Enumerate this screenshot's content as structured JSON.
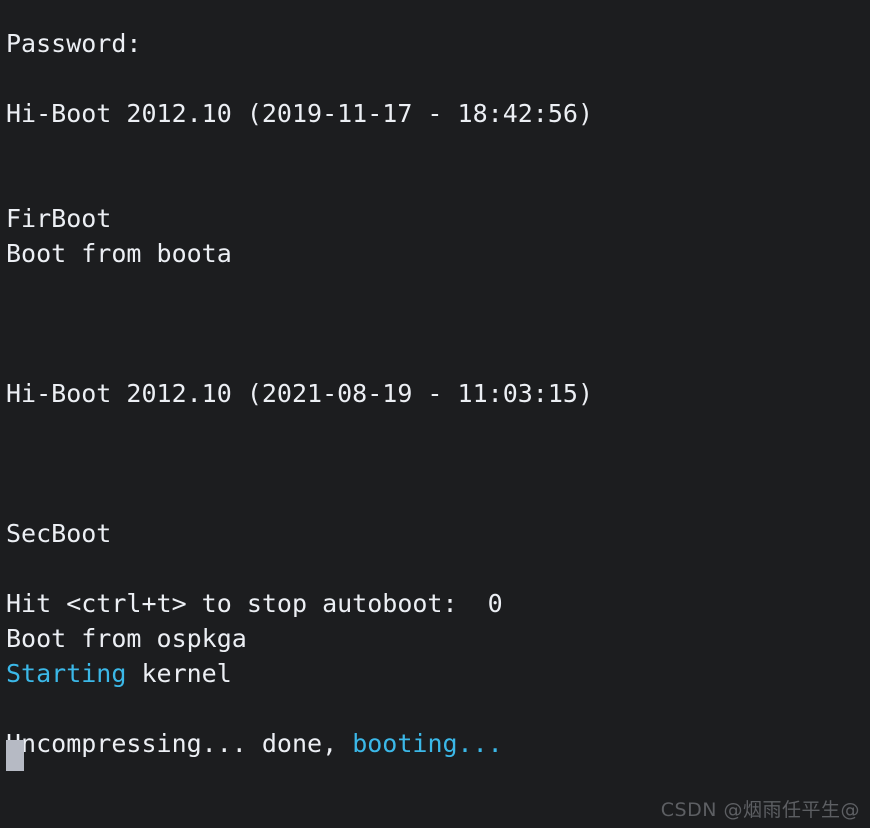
{
  "terminal": {
    "background_color": "#1c1d1f",
    "default_text_color": "#eceff4",
    "highlight_text_color": "#3bb8e8",
    "cursor_color": "#b6bac4",
    "lines": [
      {
        "id": "password-prompt",
        "segments": [
          {
            "text": "Password:",
            "color": "white"
          }
        ]
      },
      {
        "id": "blank-1",
        "segments": [
          {
            "text": " ",
            "color": "white"
          }
        ]
      },
      {
        "id": "hiboot-version-1",
        "segments": [
          {
            "text": "Hi-Boot 2012.10 (2019-11-17 - 18:42:56)",
            "color": "white"
          }
        ]
      },
      {
        "id": "blank-2",
        "segments": [
          {
            "text": " ",
            "color": "white"
          }
        ]
      },
      {
        "id": "blank-3",
        "segments": [
          {
            "text": " ",
            "color": "white"
          }
        ]
      },
      {
        "id": "firboot-label",
        "segments": [
          {
            "text": "FirBoot",
            "color": "white"
          }
        ]
      },
      {
        "id": "boot-from-boota",
        "segments": [
          {
            "text": "Boot from boota",
            "color": "white"
          }
        ]
      },
      {
        "id": "blank-4",
        "segments": [
          {
            "text": " ",
            "color": "white"
          }
        ]
      },
      {
        "id": "blank-5",
        "segments": [
          {
            "text": " ",
            "color": "white"
          }
        ]
      },
      {
        "id": "blank-6",
        "segments": [
          {
            "text": " ",
            "color": "white"
          }
        ]
      },
      {
        "id": "hiboot-version-2",
        "segments": [
          {
            "text": "Hi-Boot 2012.10 (2021-08-19 - 11:03:15)",
            "color": "white"
          }
        ]
      },
      {
        "id": "blank-7",
        "segments": [
          {
            "text": " ",
            "color": "white"
          }
        ]
      },
      {
        "id": "blank-8",
        "segments": [
          {
            "text": " ",
            "color": "white"
          }
        ]
      },
      {
        "id": "blank-9",
        "segments": [
          {
            "text": " ",
            "color": "white"
          }
        ]
      },
      {
        "id": "secboot-label",
        "segments": [
          {
            "text": "SecBoot",
            "color": "white"
          }
        ]
      },
      {
        "id": "blank-10",
        "segments": [
          {
            "text": " ",
            "color": "white"
          }
        ]
      },
      {
        "id": "autoboot-prompt",
        "segments": [
          {
            "text": "Hit <ctrl+t> to stop autoboot:  0",
            "color": "white"
          }
        ]
      },
      {
        "id": "boot-from-ospkga",
        "segments": [
          {
            "text": "Boot from ospkga",
            "color": "white"
          }
        ]
      },
      {
        "id": "starting-kernel",
        "segments": [
          {
            "text": "Starting",
            "color": "cyan"
          },
          {
            "text": " kernel",
            "color": "white"
          }
        ]
      },
      {
        "id": "blank-11",
        "segments": [
          {
            "text": " ",
            "color": "white"
          }
        ]
      },
      {
        "id": "uncompressing-booting",
        "segments": [
          {
            "text": "Uncompressing... done, ",
            "color": "white"
          },
          {
            "text": "booting...",
            "color": "cyan"
          }
        ]
      }
    ]
  },
  "watermark": {
    "text": "CSDN @烟雨任平生@"
  }
}
